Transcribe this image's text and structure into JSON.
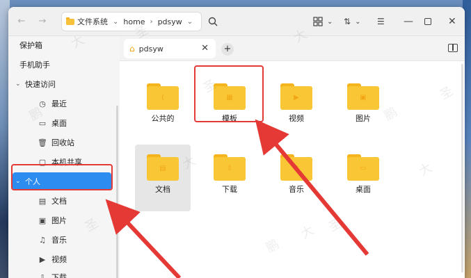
{
  "titlebar": {
    "back_icon": "arrow-left",
    "forward_icon": "arrow-right",
    "path_segments": [
      "文件系统",
      "home",
      "pdsyw"
    ],
    "view_icon": "grid-view",
    "sort_icon": "sort",
    "menu_icon": "hamburger"
  },
  "sidebar": {
    "items": [
      {
        "label": "保护箱",
        "icon": ""
      },
      {
        "label": "手机助手",
        "icon": ""
      },
      {
        "label": "快速访问",
        "icon": "chevron-down"
      },
      {
        "label": "最近",
        "icon": "clock"
      },
      {
        "label": "桌面",
        "icon": "monitor"
      },
      {
        "label": "回收站",
        "icon": "trash"
      },
      {
        "label": "本机共享",
        "icon": "folder"
      },
      {
        "label": "个人",
        "icon": "chevron-down"
      },
      {
        "label": "文档",
        "icon": "document"
      },
      {
        "label": "图片",
        "icon": "image"
      },
      {
        "label": "音乐",
        "icon": "music"
      },
      {
        "label": "视频",
        "icon": "video"
      },
      {
        "label": "下载",
        "icon": "download"
      }
    ]
  },
  "tab": {
    "label": "pdsyw",
    "icon": "home"
  },
  "folders": [
    {
      "label": "公共的",
      "icon": "share"
    },
    {
      "label": "模板",
      "icon": "template"
    },
    {
      "label": "视频",
      "icon": "video"
    },
    {
      "label": "图片",
      "icon": "image"
    },
    {
      "label": "文档",
      "icon": "document"
    },
    {
      "label": "下载",
      "icon": "download"
    },
    {
      "label": "音乐",
      "icon": "music"
    },
    {
      "label": "桌面",
      "icon": "desktop"
    }
  ],
  "watermark": "鹏 大 圣",
  "colors": {
    "accent": "#2d8cf0",
    "folder": "#f9c735",
    "highlight": "#e53935"
  }
}
